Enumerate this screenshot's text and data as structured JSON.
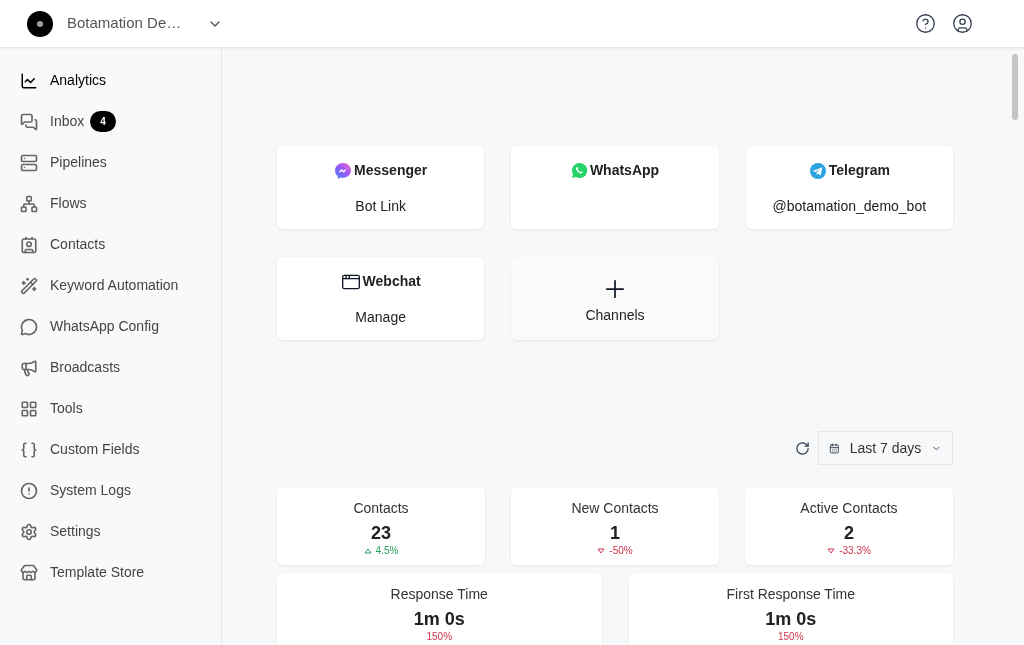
{
  "header": {
    "workspace": "Botamation De…"
  },
  "sidebar": {
    "items": [
      {
        "label": "Analytics",
        "selected": true
      },
      {
        "label": "Inbox",
        "selected": false,
        "badge": "4"
      },
      {
        "label": "Pipelines",
        "selected": false
      },
      {
        "label": "Flows",
        "selected": false
      },
      {
        "label": "Contacts",
        "selected": false
      },
      {
        "label": "Keyword Automation",
        "selected": false
      },
      {
        "label": "WhatsApp Config",
        "selected": false
      },
      {
        "label": "Broadcasts",
        "selected": false
      },
      {
        "label": "Tools",
        "selected": false
      },
      {
        "label": "Custom Fields",
        "selected": false
      },
      {
        "label": "System Logs",
        "selected": false
      },
      {
        "label": "Settings",
        "selected": false
      },
      {
        "label": "Template Store",
        "selected": false
      }
    ]
  },
  "channels": [
    {
      "kind": "messenger",
      "title": "Messenger",
      "detail": "Bot Link"
    },
    {
      "kind": "whatsapp",
      "title": "WhatsApp"
    },
    {
      "kind": "telegram",
      "title": "Telegram",
      "detail": "@botamation_demo_bot"
    },
    {
      "kind": "webchat",
      "title": "Webchat",
      "detail": "Manage"
    },
    {
      "kind": "add",
      "title": "Channels"
    }
  ],
  "date_range": {
    "value": "Last 7 days"
  },
  "stats": [
    {
      "label": "Contacts",
      "value": "23",
      "change": "4.5%",
      "kind": "up"
    },
    {
      "label": "New Contacts",
      "value": "1",
      "change": "-50%",
      "kind": "down"
    },
    {
      "label": "Active Contacts",
      "value": "2",
      "change": "-33.3%",
      "kind": "down"
    },
    {
      "label": "Response Time",
      "value": "1m 0s",
      "change": "150%",
      "kind": "plain"
    },
    {
      "label": "First Response Time",
      "value": "1m 0s",
      "change": "150%",
      "kind": "plain"
    }
  ]
}
